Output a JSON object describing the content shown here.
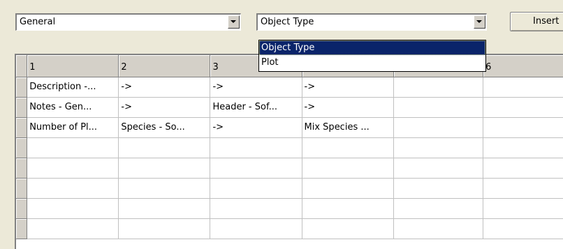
{
  "combo_left": {
    "value": "General"
  },
  "combo_right": {
    "value": "Object Type"
  },
  "insert_button": {
    "label": "Insert"
  },
  "dropdown": {
    "options": [
      "Object Type",
      "Plot"
    ],
    "selected_index": 0
  },
  "grid": {
    "columns": [
      "1",
      "2",
      "3",
      "",
      "",
      "6"
    ],
    "rows": [
      [
        "Description -...",
        "->",
        "->",
        "->",
        "",
        ""
      ],
      [
        "Notes - Gen...",
        "->",
        "Header - Sof...",
        "->",
        "",
        ""
      ],
      [
        "Number of Pl...",
        "Species - So...",
        "->",
        "Mix Species ...",
        "",
        ""
      ],
      [
        "",
        "",
        "",
        "",
        "",
        ""
      ],
      [
        "",
        "",
        "",
        "",
        "",
        ""
      ],
      [
        "",
        "",
        "",
        "",
        "",
        ""
      ],
      [
        "",
        "",
        "",
        "",
        "",
        ""
      ],
      [
        "",
        "",
        "",
        "",
        "",
        ""
      ]
    ]
  }
}
